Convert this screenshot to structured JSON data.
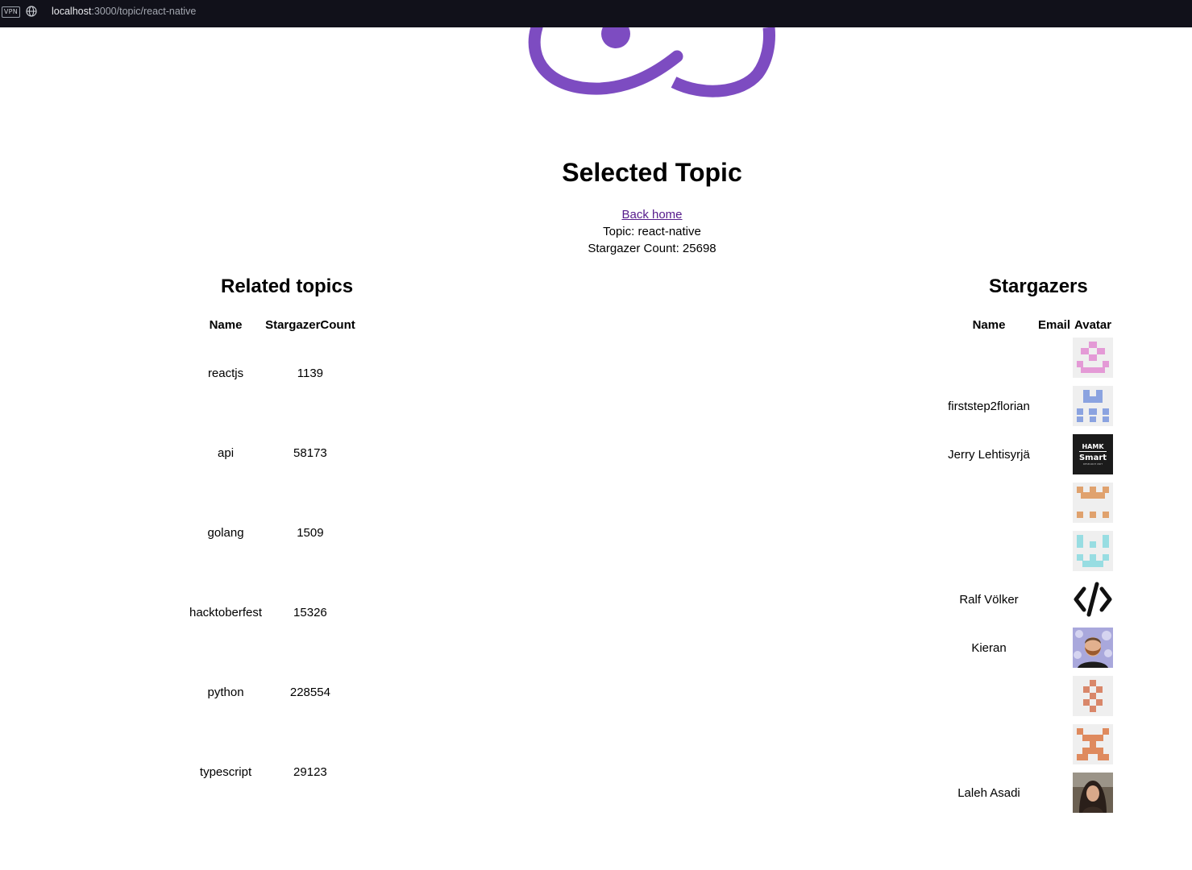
{
  "browser": {
    "vpn_label": "VPN",
    "url_host": "localhost",
    "url_path": ":3000/topic/react-native"
  },
  "page": {
    "title": "Selected Topic",
    "back_link": "Back home",
    "topic_line": "Topic: react-native",
    "count_line": "Stargazer Count: 25698"
  },
  "related": {
    "heading": "Related topics",
    "columns": [
      "Name",
      "StargazerCount"
    ],
    "rows": [
      {
        "name": "reactjs",
        "count": "1139"
      },
      {
        "name": "api",
        "count": "58173"
      },
      {
        "name": "golang",
        "count": "1509"
      },
      {
        "name": "hacktoberfest",
        "count": "15326"
      },
      {
        "name": "python",
        "count": "228554"
      },
      {
        "name": "typescript",
        "count": "29123"
      }
    ]
  },
  "stargazers": {
    "heading": "Stargazers",
    "columns": [
      "Name",
      "Email",
      "Avatar"
    ],
    "rows": [
      {
        "name": "",
        "email": "",
        "avatar": "identicon-pink-avatar"
      },
      {
        "name": "firststep2florian",
        "email": "",
        "avatar": "identicon-blue-avatar"
      },
      {
        "name": "Jerry Lehtisyrjä",
        "email": "",
        "avatar": "hamk-smart-logo-avatar",
        "avatar_text": [
          "HAMK",
          "Smart",
          "RESEARCH UNIT"
        ]
      },
      {
        "name": "",
        "email": "",
        "avatar": "identicon-orange-avatar"
      },
      {
        "name": "",
        "email": "",
        "avatar": "identicon-cyan-avatar"
      },
      {
        "name": "Ralf Völker",
        "email": "",
        "avatar": "code-brackets-avatar"
      },
      {
        "name": "Kieran",
        "email": "",
        "avatar": "bearded-man-photo-avatar"
      },
      {
        "name": "",
        "email": "",
        "avatar": "identicon-terracotta-avatar"
      },
      {
        "name": "",
        "email": "",
        "avatar": "identicon-coral-avatar"
      },
      {
        "name": "Laleh Asadi",
        "email": "",
        "avatar": "woman-photo-avatar"
      }
    ]
  },
  "colors": {
    "logo": "#7d4cc1",
    "link": "#551a8b",
    "topbar": "#11111a"
  }
}
